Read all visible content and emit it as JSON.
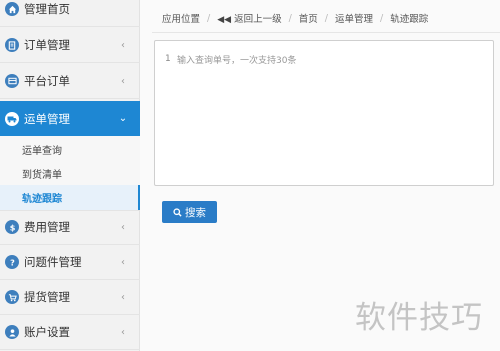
{
  "sidebar": {
    "items": [
      {
        "label": "管理首页",
        "icon": "home-icon"
      },
      {
        "label": "订单管理",
        "icon": "document-icon",
        "chevron": "‹"
      },
      {
        "label": "平台订单",
        "icon": "list-icon",
        "chevron": "‹"
      },
      {
        "label": "运单管理",
        "icon": "truck-icon",
        "chevron": "⌄",
        "active": true
      },
      {
        "label": "费用管理",
        "icon": "dollar-icon",
        "chevron": "‹"
      },
      {
        "label": "问题件管理",
        "icon": "question-icon",
        "chevron": "‹"
      },
      {
        "label": "提货管理",
        "icon": "cart-icon",
        "chevron": "‹"
      },
      {
        "label": "账户设置",
        "icon": "user-icon",
        "chevron": "‹"
      }
    ],
    "submenu": [
      {
        "label": "运单查询"
      },
      {
        "label": "到货清单"
      },
      {
        "label": "轨迹跟踪",
        "active": true
      }
    ]
  },
  "breadcrumb": {
    "location_label": "应用位置",
    "back_label": "返回上一级",
    "home": "首页",
    "section": "运单管理",
    "current": "轨迹跟踪",
    "separator": "/"
  },
  "query": {
    "line_number": "1",
    "placeholder": "输入查询单号，一次支持30条",
    "value": ""
  },
  "search_button": {
    "label": "搜索",
    "icon": "search-icon"
  },
  "watermark": {
    "text": "软件技巧"
  },
  "colors": {
    "accent": "#1e87d3",
    "button": "#2a7cc7",
    "icon": "#3e7fbd"
  }
}
